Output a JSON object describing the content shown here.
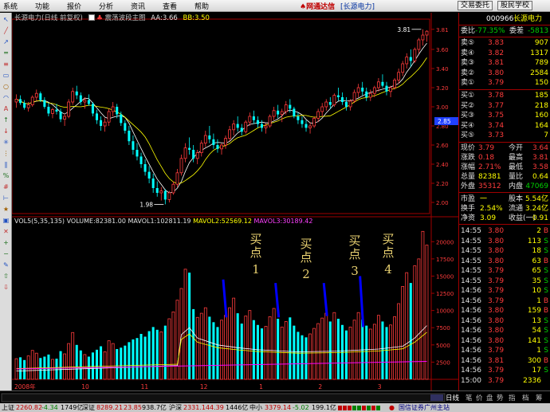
{
  "menu": {
    "items": [
      "系统",
      "功能",
      "报价",
      "分析",
      "资讯",
      "查看",
      "帮助"
    ],
    "brand": "网通达信",
    "brand_stock": "[长源电力]",
    "btn_trade": "交易委托",
    "btn_school": "股民学校"
  },
  "chart": {
    "title": "长源电力(日线 前复权)",
    "indicator_name": "震荡波段主图",
    "aa": "AA:3.66",
    "bb": "BB:3.50",
    "price_high_label": "3.81",
    "price_low_label": "1.98",
    "price_axis": [
      "3.81",
      "3.60",
      "3.40",
      "3.20",
      "3.00",
      "2.80",
      "2.60",
      "2.40",
      "2.20",
      "2.00"
    ],
    "current_price_tag": "2.85",
    "vol_info": {
      "header": "VOL5(5,35,135)",
      "volume": "VOLUME:82381.00",
      "mavol1": "MAVOL1:102811.19",
      "mavol2": "MAVOL2:52569.12",
      "mavol3": "MAVOL3:30189.42"
    },
    "vol_axis": [
      "20000",
      "17500",
      "15000",
      "12500",
      "10000",
      "7500",
      "5000",
      "2500"
    ],
    "x_labels": [
      "2008年",
      "10",
      "11",
      "12",
      "1",
      "2",
      "3"
    ],
    "annotations": [
      {
        "line1": "买",
        "line2": "点",
        "num": "1"
      },
      {
        "line1": "买",
        "line2": "点",
        "num": "2"
      },
      {
        "line1": "买",
        "line2": "点",
        "num": "3"
      },
      {
        "line1": "买",
        "line2": "点",
        "num": "4"
      }
    ],
    "colors": {
      "up": "#ff3c3c",
      "down": "#00ffff",
      "ma1": "#ffffff",
      "ma2": "#ffff00",
      "ma3": "#ff00ff",
      "marker": "#0000ff"
    },
    "candles": [
      [
        3.05,
        3.13,
        2.99,
        3.08
      ],
      [
        3.08,
        3.12,
        3.02,
        3.04
      ],
      [
        3.04,
        3.07,
        2.97,
        2.99
      ],
      [
        2.99,
        3.05,
        2.95,
        3.02
      ],
      [
        3.02,
        3.12,
        3.0,
        3.1
      ],
      [
        3.1,
        3.18,
        3.06,
        3.14
      ],
      [
        3.14,
        3.16,
        3.05,
        3.07
      ],
      [
        3.07,
        3.1,
        2.98,
        3.0
      ],
      [
        3.0,
        3.04,
        2.9,
        2.93
      ],
      [
        2.93,
        2.99,
        2.88,
        2.97
      ],
      [
        2.97,
        3.03,
        2.92,
        2.95
      ],
      [
        2.95,
        2.98,
        2.84,
        2.87
      ],
      [
        2.87,
        2.93,
        2.8,
        2.9
      ],
      [
        2.9,
        3.08,
        2.88,
        3.05
      ],
      [
        3.05,
        3.2,
        3.02,
        3.16
      ],
      [
        3.16,
        3.22,
        3.08,
        3.12
      ],
      [
        3.12,
        3.15,
        3.02,
        3.05
      ],
      [
        3.05,
        3.1,
        2.98,
        3.07
      ],
      [
        3.07,
        3.13,
        3.01,
        3.03
      ],
      [
        3.03,
        3.05,
        2.9,
        2.93
      ],
      [
        2.93,
        2.97,
        2.82,
        2.86
      ],
      [
        2.86,
        2.9,
        2.75,
        2.8
      ],
      [
        2.8,
        2.88,
        2.74,
        2.84
      ],
      [
        2.84,
        2.98,
        2.8,
        2.95
      ],
      [
        2.95,
        3.05,
        2.9,
        3.0
      ],
      [
        3.0,
        3.03,
        2.88,
        2.92
      ],
      [
        2.92,
        2.95,
        2.8,
        2.83
      ],
      [
        2.83,
        2.86,
        2.72,
        2.75
      ],
      [
        2.75,
        2.8,
        2.6,
        2.64
      ],
      [
        2.64,
        2.7,
        2.5,
        2.55
      ],
      [
        2.55,
        2.62,
        2.44,
        2.48
      ],
      [
        2.48,
        2.52,
        2.36,
        2.4
      ],
      [
        2.4,
        2.45,
        2.28,
        2.32
      ],
      [
        2.32,
        2.38,
        2.2,
        2.25
      ],
      [
        2.25,
        2.3,
        2.1,
        2.15
      ],
      [
        2.15,
        2.22,
        2.06,
        2.1
      ],
      [
        2.1,
        2.16,
        2.02,
        2.12
      ],
      [
        2.12,
        2.14,
        1.98,
        2.03
      ],
      [
        2.03,
        2.12,
        2.0,
        2.1
      ],
      [
        2.1,
        2.22,
        2.08,
        2.19
      ],
      [
        2.19,
        2.35,
        2.16,
        2.31
      ],
      [
        2.31,
        2.5,
        2.28,
        2.46
      ],
      [
        2.46,
        2.62,
        2.42,
        2.57
      ],
      [
        2.57,
        2.68,
        2.5,
        2.55
      ],
      [
        2.55,
        2.6,
        2.42,
        2.46
      ],
      [
        2.46,
        2.55,
        2.4,
        2.52
      ],
      [
        2.52,
        2.65,
        2.48,
        2.62
      ],
      [
        2.62,
        2.75,
        2.58,
        2.7
      ],
      [
        2.7,
        2.8,
        2.62,
        2.66
      ],
      [
        2.66,
        2.72,
        2.56,
        2.6
      ],
      [
        2.6,
        2.66,
        2.52,
        2.56
      ],
      [
        2.56,
        2.62,
        2.5,
        2.6
      ],
      [
        2.6,
        2.7,
        2.56,
        2.67
      ],
      [
        2.67,
        2.8,
        2.64,
        2.76
      ],
      [
        2.76,
        2.86,
        2.7,
        2.82
      ],
      [
        2.82,
        2.9,
        2.74,
        2.78
      ],
      [
        2.78,
        2.82,
        2.7,
        2.74
      ],
      [
        2.74,
        2.86,
        2.72,
        2.84
      ],
      [
        2.84,
        2.94,
        2.8,
        2.9
      ],
      [
        2.9,
        2.96,
        2.82,
        2.86
      ],
      [
        2.86,
        2.9,
        2.78,
        2.82
      ],
      [
        2.82,
        2.86,
        2.74,
        2.78
      ],
      [
        2.78,
        2.83,
        2.72,
        2.8
      ],
      [
        2.8,
        2.92,
        2.78,
        2.9
      ],
      [
        2.9,
        3.0,
        2.86,
        2.96
      ],
      [
        2.96,
        3.02,
        2.88,
        2.92
      ],
      [
        2.92,
        2.98,
        2.84,
        2.95
      ],
      [
        2.95,
        3.06,
        2.92,
        3.02
      ],
      [
        3.02,
        3.08,
        2.94,
        2.98
      ],
      [
        2.98,
        3.0,
        2.88,
        2.9
      ],
      [
        2.9,
        2.94,
        2.82,
        2.86
      ],
      [
        2.86,
        2.9,
        2.78,
        2.82
      ],
      [
        2.82,
        2.86,
        2.74,
        2.78
      ],
      [
        2.78,
        2.84,
        2.72,
        2.8
      ],
      [
        2.8,
        2.9,
        2.78,
        2.88
      ],
      [
        2.88,
        2.98,
        2.84,
        2.95
      ],
      [
        2.95,
        3.04,
        2.9,
        3.0
      ],
      [
        3.0,
        3.08,
        2.96,
        3.05
      ],
      [
        3.05,
        3.1,
        2.98,
        3.02
      ],
      [
        3.02,
        3.14,
        3.0,
        3.12
      ],
      [
        3.12,
        3.2,
        3.06,
        3.1
      ],
      [
        3.1,
        3.15,
        3.02,
        3.05
      ],
      [
        3.05,
        3.1,
        2.96,
        3.0
      ],
      [
        3.0,
        3.08,
        2.96,
        3.06
      ],
      [
        3.06,
        3.18,
        3.04,
        3.15
      ],
      [
        3.15,
        3.24,
        3.1,
        3.2
      ],
      [
        3.2,
        3.26,
        3.12,
        3.16
      ],
      [
        3.16,
        3.2,
        3.06,
        3.1
      ],
      [
        3.1,
        3.18,
        3.06,
        3.14
      ],
      [
        3.14,
        3.22,
        3.1,
        3.2
      ],
      [
        3.2,
        3.3,
        3.16,
        3.26
      ],
      [
        3.26,
        3.34,
        3.2,
        3.22
      ],
      [
        3.22,
        3.26,
        3.12,
        3.16
      ],
      [
        3.16,
        3.22,
        3.1,
        3.2
      ],
      [
        3.2,
        3.3,
        3.18,
        3.28
      ],
      [
        3.28,
        3.4,
        3.24,
        3.36
      ],
      [
        3.36,
        3.48,
        3.32,
        3.45
      ],
      [
        3.45,
        3.56,
        3.4,
        3.52
      ],
      [
        3.52,
        3.6,
        3.42,
        3.48
      ],
      [
        3.48,
        3.62,
        3.46,
        3.6
      ],
      [
        3.6,
        3.72,
        3.56,
        3.7
      ],
      [
        3.7,
        3.81,
        3.64,
        3.75
      ],
      [
        3.75,
        3.8,
        3.68,
        3.79
      ]
    ],
    "volumes": [
      3000,
      3200,
      2800,
      3400,
      4200,
      3800,
      3100,
      3300,
      3600,
      2900,
      3000,
      4100,
      3700,
      5200,
      6800,
      5000,
      4200,
      3600,
      3300,
      3900,
      4300,
      4800,
      4000,
      5600,
      5200,
      4400,
      4600,
      4900,
      5400,
      5800,
      6000,
      6600,
      6200,
      7000,
      7600,
      7200,
      6900,
      7800,
      8800,
      9800,
      11500,
      13200,
      16000,
      15500,
      10200,
      9000,
      9600,
      10400,
      9100,
      8300,
      7600,
      8600,
      9300,
      10400,
      11800,
      9600,
      8100,
      9200,
      10000,
      8600,
      7900,
      7400,
      7700,
      9100,
      10300,
      8800,
      7600,
      8400,
      9000,
      7800,
      6900,
      6400,
      6100,
      6600,
      7400,
      8100,
      8900,
      9600,
      8400,
      9700,
      8800,
      7900,
      7100,
      7600,
      8600,
      9700,
      8700,
      7800,
      7300,
      8000,
      9300,
      8400,
      7600,
      7900,
      9100,
      11000,
      13500,
      15500,
      14000,
      16500,
      17500,
      21500,
      19500
    ],
    "mavol_pts": [
      [
        0,
        1200
      ],
      [
        20,
        1600
      ],
      [
        40,
        2000
      ],
      [
        41,
        6500
      ],
      [
        43,
        7500
      ],
      [
        45,
        6000
      ],
      [
        50,
        5000
      ],
      [
        55,
        4600
      ],
      [
        60,
        4300
      ],
      [
        70,
        4000
      ],
      [
        80,
        4100
      ],
      [
        90,
        4400
      ],
      [
        96,
        4800
      ],
      [
        99,
        6000
      ],
      [
        102,
        7800
      ]
    ]
  },
  "quote": {
    "code": "000966",
    "name": "长源电力",
    "weibi_label": "委比",
    "weibi": "-77.35%",
    "weicha_label": "委差",
    "weicha": "-5813",
    "sells": [
      {
        "label": "卖⑤",
        "price": "3.83",
        "vol": "907"
      },
      {
        "label": "卖④",
        "price": "3.82",
        "vol": "1317"
      },
      {
        "label": "卖③",
        "price": "3.81",
        "vol": "789"
      },
      {
        "label": "卖②",
        "price": "3.80",
        "vol": "2584"
      },
      {
        "label": "卖①",
        "price": "3.79",
        "vol": "150"
      }
    ],
    "buys": [
      {
        "label": "买①",
        "price": "3.78",
        "vol": "185"
      },
      {
        "label": "买②",
        "price": "3.77",
        "vol": "218"
      },
      {
        "label": "买③",
        "price": "3.75",
        "vol": "160"
      },
      {
        "label": "买④",
        "price": "3.74",
        "vol": "164"
      },
      {
        "label": "买⑤",
        "price": "3.73",
        "vol": "7"
      }
    ],
    "stats": [
      {
        "l1": "现价",
        "v1": "3.79",
        "l2": "今开",
        "v2": "3.64"
      },
      {
        "l1": "涨跌",
        "v1": "0.18",
        "l2": "最高",
        "v2": "3.81"
      },
      {
        "l1": "涨幅",
        "v1": "2.71%",
        "l2": "最低",
        "v2": "3.58"
      },
      {
        "l1": "总量",
        "v1": "82381",
        "l2": "量比",
        "v2": "0.64"
      },
      {
        "l1": "外盘",
        "v1": "35312",
        "l2": "内盘",
        "v2": "47069"
      }
    ],
    "fund": [
      {
        "l1": "市盈",
        "v1": "一",
        "l2": "股本",
        "v2": "5.54亿"
      },
      {
        "l1": "换手",
        "v1": "2.54%",
        "l2": "流通",
        "v2": "3.24亿"
      },
      {
        "l1": "净资",
        "v1": "3.09",
        "l2": "收益(一)",
        "v2": "0.91"
      }
    ],
    "ticks": [
      {
        "t": "14:55",
        "p": "3.80",
        "v": "2",
        "d": "B"
      },
      {
        "t": "14:55",
        "p": "3.80",
        "v": "113",
        "d": "S"
      },
      {
        "t": "14:55",
        "p": "3.80",
        "v": "18",
        "d": "S"
      },
      {
        "t": "14:55",
        "p": "3.80",
        "v": "63",
        "d": "B"
      },
      {
        "t": "14:55",
        "p": "3.79",
        "v": "65",
        "d": "S"
      },
      {
        "t": "14:55",
        "p": "3.79",
        "v": "35",
        "d": "S"
      },
      {
        "t": "14:56",
        "p": "3.79",
        "v": "10",
        "d": "S"
      },
      {
        "t": "14:56",
        "p": "3.79",
        "v": "1",
        "d": "B"
      },
      {
        "t": "14:56",
        "p": "3.80",
        "v": "159",
        "d": "B"
      },
      {
        "t": "14:56",
        "p": "3.80",
        "v": "13",
        "d": "S"
      },
      {
        "t": "14:56",
        "p": "3.80",
        "v": "54",
        "d": "S"
      },
      {
        "t": "14:56",
        "p": "3.80",
        "v": "141",
        "d": "S"
      },
      {
        "t": "14:56",
        "p": "3.79",
        "v": "1",
        "d": "S"
      },
      {
        "t": "14:56",
        "p": "3.81",
        "v": "300",
        "d": "B"
      },
      {
        "t": "14:56",
        "p": "3.79",
        "v": "17",
        "d": "S"
      },
      {
        "t": "15:00",
        "p": "3.79",
        "v": "2336",
        "d": ""
      }
    ]
  },
  "bottom_tabs": [
    "日线",
    "笔",
    "价",
    "盘",
    "势",
    "指",
    "档",
    "筹"
  ],
  "status": {
    "sh_label": "上证",
    "sh": "2260.82",
    "sh_chg": "-4.34",
    "sh_amt": "1749亿",
    "sz_label": "深证",
    "sz": "8289.21",
    "sz_chg": "23.85",
    "sz_amt": "938.7亿",
    "hs_label": "沪深",
    "hs": "2331.14",
    "hs_chg": "4.39",
    "hs_amt": "1446亿",
    "zx_label": "中小",
    "zx": "3379.14",
    "zx_chg": "-5.02",
    "zx_amt": "199.1亿",
    "site": "国信证券广州主站"
  }
}
